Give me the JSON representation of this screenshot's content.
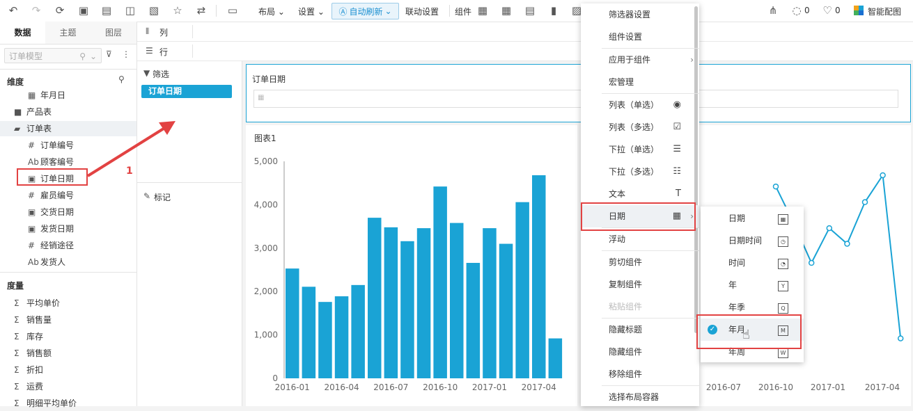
{
  "toolbar": {
    "layout": "布局",
    "settings": "设置",
    "auto_refresh": "自动刷新",
    "linkage": "联动设置",
    "components": "组件",
    "comments_count": "0",
    "likes_count": "0",
    "smart_color": "智能配图"
  },
  "left": {
    "tabs": [
      "数据",
      "主题",
      "图层"
    ],
    "model_placeholder": "订单模型",
    "dimensions_title": "维度",
    "dimensions": [
      {
        "icon": "calendar-icon",
        "label": "年月日",
        "glyph": "▦"
      },
      {
        "icon": "folder-icon",
        "label": "产品表",
        "glyph": "■"
      },
      {
        "icon": "folder-open-icon",
        "label": "订单表",
        "glyph": "▰"
      },
      {
        "icon": "number-icon",
        "label": "订单编号",
        "glyph": "#"
      },
      {
        "icon": "text-icon",
        "label": "顾客编号",
        "glyph": "Ab"
      },
      {
        "icon": "date-icon",
        "label": "订单日期",
        "glyph": "▣"
      },
      {
        "icon": "number-icon",
        "label": "雇员编号",
        "glyph": "#"
      },
      {
        "icon": "date-icon",
        "label": "交货日期",
        "glyph": "▣"
      },
      {
        "icon": "date-icon",
        "label": "发货日期",
        "glyph": "▣"
      },
      {
        "icon": "number-icon",
        "label": "经销途径",
        "glyph": "#"
      },
      {
        "icon": "text-icon",
        "label": "发货人",
        "glyph": "Ab"
      }
    ],
    "measures_title": "度量",
    "measures": [
      "平均单价",
      "销售量",
      "库存",
      "销售额",
      "折扣",
      "运费",
      "明细平均单价"
    ]
  },
  "mid": {
    "columns_label": "列",
    "rows_label": "行",
    "filter_label": "筛选",
    "filter_chip": "订单日期",
    "marks_label": "标记",
    "annotation_number": "1"
  },
  "filter_widget": {
    "title": "订单日期"
  },
  "chart_widget": {
    "title": "图表1"
  },
  "chart_data": [
    {
      "type": "bar",
      "title": "图表1",
      "xlabel": "",
      "ylabel": "",
      "ylim": [
        0,
        5000
      ],
      "yticks": [
        "0",
        "1,000",
        "2,000",
        "3,000",
        "4,000",
        "5,000"
      ],
      "xticks": [
        "2016-01",
        "2016-04",
        "2016-07",
        "2016-10",
        "2017-01",
        "2017-04"
      ],
      "categories": [
        "2016-01",
        "2016-02",
        "2016-03",
        "2016-04",
        "2016-05",
        "2016-06",
        "2016-07",
        "2016-08",
        "2016-09",
        "2016-10",
        "2016-11",
        "2016-12",
        "2017-01",
        "2017-02",
        "2017-03",
        "2017-04",
        "2017-05",
        "2017-06"
      ],
      "values": [
        2530,
        2110,
        1760,
        1890,
        2150,
        3700,
        3480,
        3160,
        3460,
        4420,
        3580,
        2660,
        3460,
        3100,
        4060,
        4680,
        920,
        0
      ],
      "color": "#1aa3d5",
      "grid": false
    },
    {
      "type": "line",
      "xticks": [
        "2016-07",
        "2016-10",
        "2017-01",
        "2017-04"
      ],
      "categories": [
        "2016-10",
        "2016-11",
        "2016-12",
        "2017-01",
        "2017-02",
        "2017-03",
        "2017-04",
        "2017-05"
      ],
      "values": [
        4420,
        3580,
        2660,
        3460,
        3100,
        4060,
        4680,
        920
      ],
      "ylim": [
        0,
        5000
      ],
      "color": "#1aa3d5"
    }
  ],
  "menu": {
    "items": [
      {
        "label": "筛选器设置",
        "icon": "",
        "arrow": false
      },
      {
        "label": "组件设置",
        "icon": "",
        "arrow": false
      },
      {
        "label": "应用于组件",
        "icon": "",
        "arrow": true
      },
      {
        "label": "宏管理",
        "icon": "",
        "arrow": false
      },
      {
        "label": "列表（单选）",
        "icon": "◉",
        "arrow": false
      },
      {
        "label": "列表（多选）",
        "icon": "☑",
        "arrow": false
      },
      {
        "label": "下拉（单选）",
        "icon": "☰",
        "arrow": false
      },
      {
        "label": "下拉（多选）",
        "icon": "☷",
        "arrow": false
      },
      {
        "label": "文本",
        "icon": "T",
        "arrow": false
      },
      {
        "label": "日期",
        "icon": "▦",
        "arrow": true
      },
      {
        "label": "浮动",
        "icon": "",
        "arrow": false
      },
      {
        "label": "剪切组件",
        "icon": "",
        "arrow": false
      },
      {
        "label": "复制组件",
        "icon": "",
        "arrow": false
      },
      {
        "label": "粘贴组件",
        "icon": "",
        "arrow": false,
        "disabled": true
      },
      {
        "label": "隐藏标题",
        "icon": "",
        "arrow": false
      },
      {
        "label": "隐藏组件",
        "icon": "",
        "arrow": false
      },
      {
        "label": "移除组件",
        "icon": "",
        "arrow": false
      },
      {
        "label": "选择布局容器",
        "icon": "",
        "arrow": false
      }
    ]
  },
  "submenu": {
    "items": [
      {
        "label": "日期",
        "icon": "▦"
      },
      {
        "label": "日期时间",
        "icon": "◷"
      },
      {
        "label": "时间",
        "icon": "◔"
      },
      {
        "label": "年",
        "icon": "Y"
      },
      {
        "label": "年季",
        "icon": "Q"
      },
      {
        "label": "年月",
        "icon": "M",
        "checked": true
      },
      {
        "label": "年周",
        "icon": "W"
      }
    ]
  },
  "colors": {
    "accent": "#1aa3d5",
    "annotation": "#e24242"
  }
}
